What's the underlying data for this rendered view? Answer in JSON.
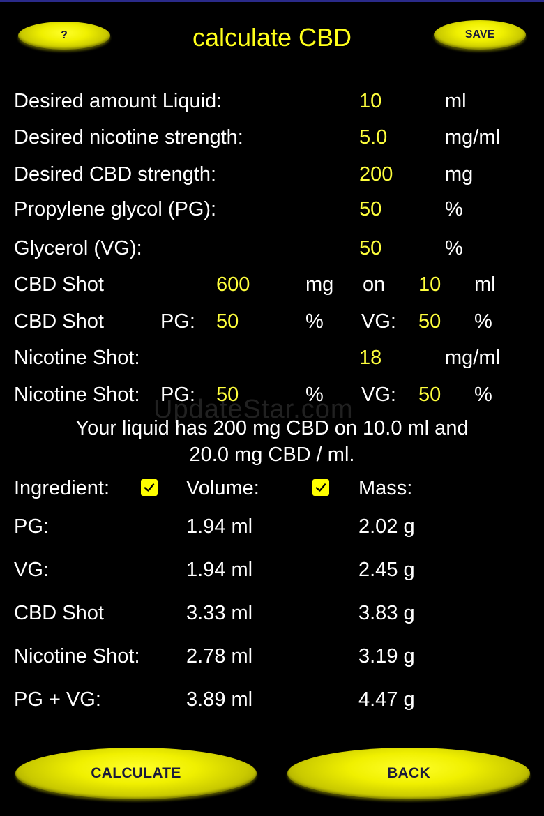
{
  "header": {
    "help_label": "?",
    "title": "calculate CBD",
    "save_label": "SAVE"
  },
  "inputs": {
    "liquid": {
      "label": "Desired amount Liquid:",
      "value": "10",
      "unit": "ml"
    },
    "nicotine": {
      "label": "Desired nicotine strength:",
      "value": "5.0",
      "unit": "mg/ml"
    },
    "cbd": {
      "label": "Desired CBD strength:",
      "value": "200",
      "unit": "mg"
    },
    "pg": {
      "label": "Propylene glycol (PG):",
      "value": "50",
      "unit": "%"
    },
    "vg": {
      "label": "Glycerol (VG):",
      "value": "50",
      "unit": "%"
    },
    "cbd_shot": {
      "label": "CBD Shot",
      "mg_value": "600",
      "mg_unit": "mg",
      "on_label": "on",
      "ml_value": "10",
      "ml_unit": "ml"
    },
    "cbd_shot_ratio": {
      "label": "CBD Shot",
      "pg_label": "PG:",
      "pg_value": "50",
      "pg_unit": "%",
      "vg_label": "VG:",
      "vg_value": "50",
      "vg_unit": "%"
    },
    "nic_shot": {
      "label": "Nicotine Shot:",
      "value": "18",
      "unit": "mg/ml"
    },
    "nic_shot_ratio": {
      "label": "Nicotine Shot:",
      "pg_label": "PG:",
      "pg_value": "50",
      "pg_unit": "%",
      "vg_label": "VG:",
      "vg_value": "50",
      "vg_unit": "%"
    }
  },
  "watermark": "UpdateStar.com",
  "result": {
    "line1": "Your liquid has 200 mg CBD on 10.0 ml and",
    "line2": "20.0 mg CBD / ml."
  },
  "table": {
    "headers": {
      "ingredient": "Ingredient:",
      "volume": "Volume:",
      "mass": "Mass:"
    },
    "volume_checked": true,
    "mass_checked": true,
    "rows": [
      {
        "name": "PG:",
        "volume": "1.94 ml",
        "mass": "2.02 g"
      },
      {
        "name": "VG:",
        "volume": "1.94 ml",
        "mass": "2.45 g"
      },
      {
        "name": "CBD Shot",
        "volume": "3.33 ml",
        "mass": "3.83 g"
      },
      {
        "name": "Nicotine Shot:",
        "volume": "2.78 ml",
        "mass": "3.19 g"
      },
      {
        "name": "PG + VG:",
        "volume": "3.89 ml",
        "mass": "4.47 g"
      }
    ]
  },
  "footer": {
    "calculate_label": "CALCULATE",
    "back_label": "BACK"
  },
  "colors": {
    "background": "#000000",
    "value_yellow": "#ffff3c",
    "button_yellow": "#f0f000",
    "button_text": "#1a1a3a"
  }
}
